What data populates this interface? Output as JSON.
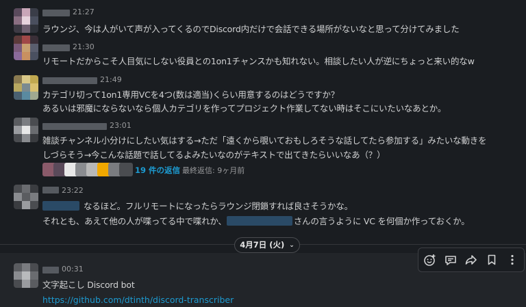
{
  "messages": [
    {
      "time": "21:27",
      "lines": [
        "ラウンジ、今は人がいて声が入ってくるのでDiscord内だけで会話できる場所がないなと思って分けてみました"
      ]
    },
    {
      "time": "21:30",
      "lines": [
        "リモートだからこそ人目気にしない役員との1on1チャンスかも知れない。相談したい人が逆にちょっと来い的なw"
      ]
    },
    {
      "time": "21:49",
      "lines": [
        "カテゴリ切って1on1専用VCを4つ(数は適当)くらい用意するのはどうですか？",
        "あるいは邪魔にならないなら個人カテゴリを作ってプロジェクト作業してない時はそこにいたいなあとか。"
      ]
    },
    {
      "time": "23:01",
      "lines": [
        "雑談チャンネル小分けにしたい気はする→ただ「遠くから覗いておもしろそうな話してたら参加する」みたいな動きを",
        "しづらそう→今こんな話題で話してるよみたいなのがテキストで出てきたらいいなあ（？）"
      ],
      "thread": {
        "replies": "19 件の返信",
        "last_reply": "最終返信: 9ヶ月前"
      }
    },
    {
      "time": "23:22",
      "line1": "なるほど。フルリモートになったらラウンジ閉鎖すれば良さそうかな。",
      "line2_pre": "それとも、あえて他の人が喋ってる中で喋れか、",
      "line2_post": "さんの言うように VC を何個か作っておくか。"
    },
    {
      "time": "00:31",
      "lines": [
        "文字起こし Discord bot"
      ],
      "link": "https://github.com/dtinth/discord-transcriber"
    }
  ],
  "date_divider": "4月7日 (火)",
  "toolbar_icons": [
    "add-reaction-icon",
    "reply-in-thread-icon",
    "share-icon",
    "bookmark-icon",
    "more-actions-icon"
  ],
  "colors": {
    "background": "#1a1d21",
    "link": "#1d9bd1",
    "text": "#d1d2d3"
  }
}
